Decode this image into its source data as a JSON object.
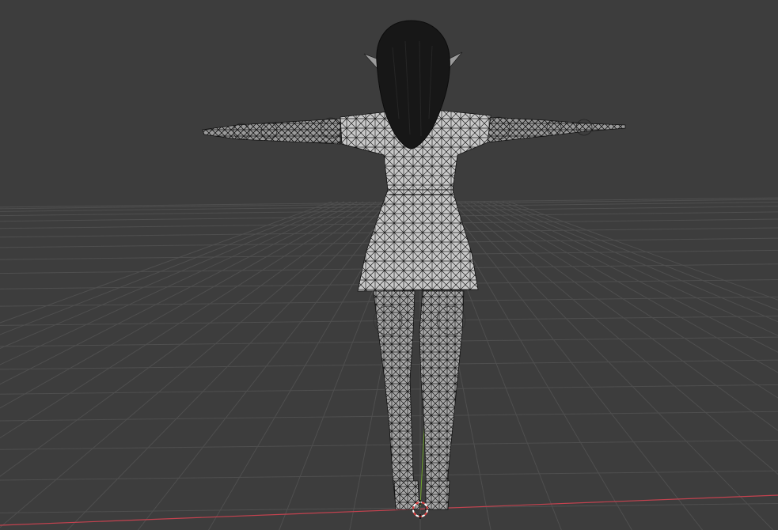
{
  "viewport": {
    "background": "#3d3d3d",
    "grid_color": "#4f4f4f",
    "x_axis_color": "#c4424f",
    "y_axis_color": "#6fa42b"
  },
  "model": {
    "description_icon": "wireframe-character-model",
    "mesh_fill": "#c7c7c7",
    "mesh_wire": "#1a1a1a",
    "hair_color": "#161616"
  },
  "cursor": {
    "icon": "3d-cursor-icon",
    "ring_color_a": "#e04040",
    "ring_color_b": "#ffffff"
  }
}
